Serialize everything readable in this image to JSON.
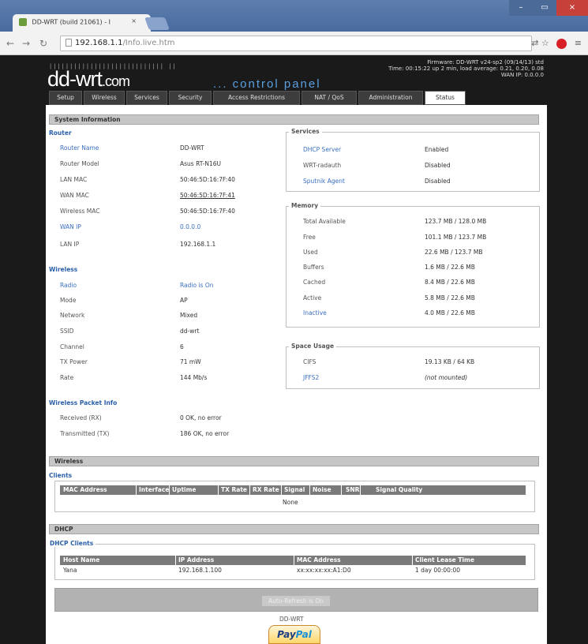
{
  "browser": {
    "tab_title": "DD-WRT (build 21061) - I",
    "url_host": "192.168.1.1",
    "url_path": "/Info.live.htm"
  },
  "header": {
    "dots": "|||||||||||||||||||||||||||| ||",
    "logo": "dd-wrt",
    "logo_suffix": ".com",
    "control_panel": "... control panel",
    "info_line1": "Firmware: DD-WRT v24-sp2 (09/14/13) std",
    "info_line2": "Time: 00:15:22 up 2 min, load average: 0.21, 0.20, 0.08",
    "info_line3": "WAN IP: 0.0.0.0"
  },
  "menu": [
    "Setup",
    "Wireless",
    "Services",
    "Security",
    "Access Restrictions",
    "NAT / QoS",
    "Administration",
    "Status"
  ],
  "system": {
    "bar": "System Information",
    "router_title": "Router",
    "router_rows": [
      {
        "label": "Router Name",
        "value": "DD-WRT"
      },
      {
        "label": "Router Model",
        "value": "Asus RT-N16U"
      },
      {
        "label": "LAN MAC",
        "value": "50:46:5D:16:7F:40"
      },
      {
        "label": "WAN MAC",
        "value": "50:46:5D:16:7F:41"
      },
      {
        "label": "Wireless MAC",
        "value": "50:46:5D:16:7F:40"
      },
      {
        "label": "WAN IP",
        "value": "0.0.0.0"
      },
      {
        "label": "LAN IP",
        "value": "192.168.1.1"
      }
    ],
    "services_legend": "Services",
    "services_rows": [
      {
        "label": "DHCP Server",
        "value": "Enabled"
      },
      {
        "label": "WRT-radauth",
        "value": "Disabled"
      },
      {
        "label": "Sputnik Agent",
        "value": "Disabled"
      }
    ],
    "memory_legend": "Memory",
    "memory_rows": [
      {
        "label": "Total Available",
        "value": "123.7 MB / 128.0 MB"
      },
      {
        "label": "Free",
        "value": "101.1 MB / 123.7 MB"
      },
      {
        "label": "Used",
        "value": "22.6 MB / 123.7 MB"
      },
      {
        "label": "Buffers",
        "value": "1.6 MB / 22.6 MB"
      },
      {
        "label": "Cached",
        "value": "8.4 MB / 22.6 MB"
      },
      {
        "label": "Active",
        "value": "5.8 MB / 22.6 MB"
      },
      {
        "label": "Inactive",
        "value": "4.0 MB / 22.6 MB"
      }
    ],
    "space_legend": "Space Usage",
    "space_rows": [
      {
        "label": "CIFS",
        "value": "19.13 KB / 64 KB"
      },
      {
        "label": "JFFS2",
        "value": "(not mounted)"
      }
    ],
    "wireless_title": "Wireless",
    "wireless_rows": [
      {
        "label": "Radio",
        "value": "Radio is On"
      },
      {
        "label": "Mode",
        "value": "AP"
      },
      {
        "label": "Network",
        "value": "Mixed"
      },
      {
        "label": "SSID",
        "value": "dd-wrt"
      },
      {
        "label": "Channel",
        "value": "6"
      },
      {
        "label": "TX Power",
        "value": "71 mW"
      },
      {
        "label": "Rate",
        "value": "144 Mb/s"
      }
    ],
    "packet_title": "Wireless Packet Info",
    "packet_rows": [
      {
        "label": "Received (RX)",
        "value": "0 OK, no error"
      },
      {
        "label": "Transmitted (TX)",
        "value": "186 OK, no error"
      }
    ]
  },
  "wireless_section": {
    "bar": "Wireless",
    "clients_title": "Clients",
    "columns": [
      "MAC Address",
      "Interface",
      "Uptime",
      "TX Rate",
      "RX Rate",
      "Signal",
      "Noise",
      "SNR",
      "Signal Quality"
    ],
    "empty": "None"
  },
  "dhcp_section": {
    "bar": "DHCP",
    "clients_legend": "DHCP Clients",
    "columns": [
      "Host Name",
      "IP Address",
      "MAC Address",
      "Client Lease Time"
    ],
    "row": {
      "host": "Yana",
      "ip": "192.168.1.100",
      "mac": "xx:xx:xx:xx:A1:D0",
      "lease": "1 day 00:00:00"
    }
  },
  "footer": {
    "auto_refresh": "Auto-Refresh is On",
    "text": "DD-WRT",
    "paypal_pay": "Pay",
    "paypal_pal": "Pal"
  }
}
